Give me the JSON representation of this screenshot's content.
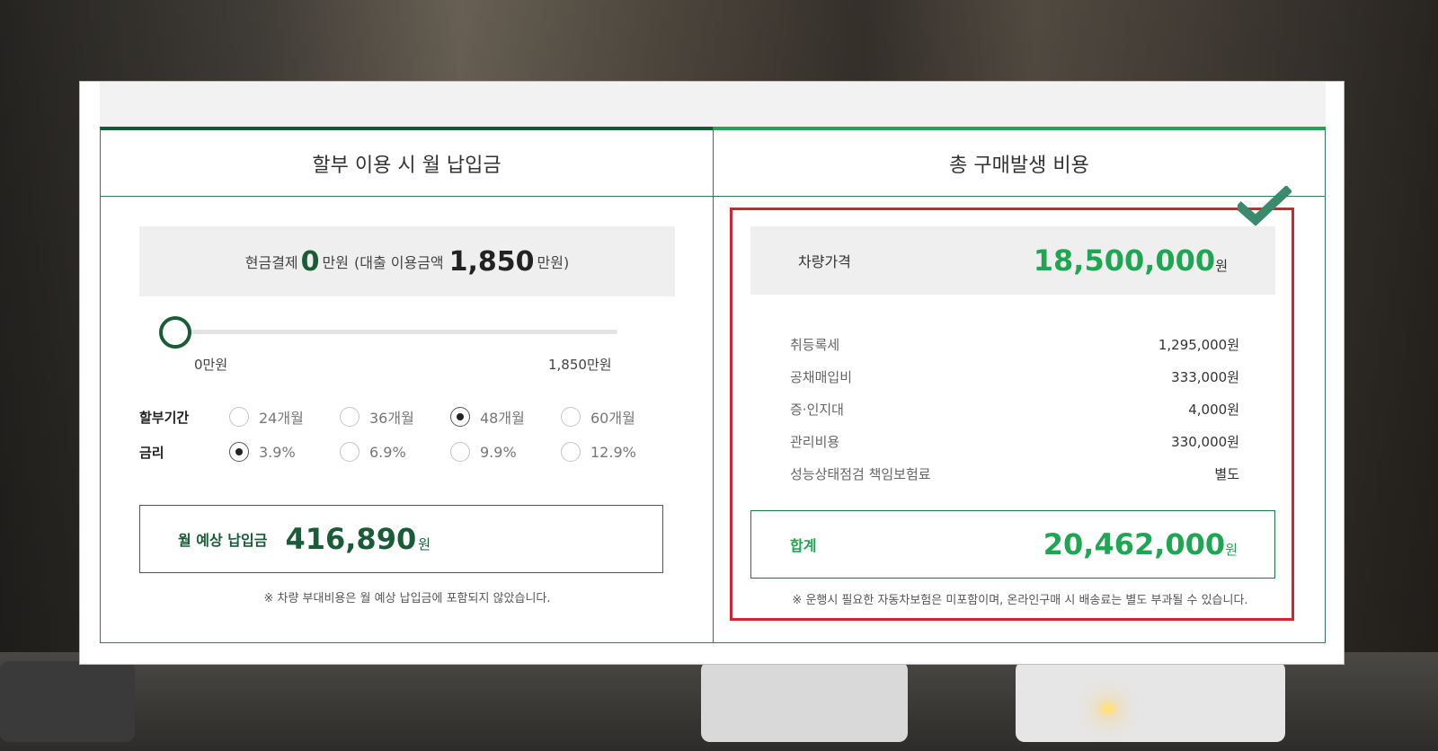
{
  "installment_panel": {
    "title": "할부 이용 시 월 납입금",
    "cash": {
      "prefix": "현금결제",
      "cash_value": "0",
      "cash_unit": "만원",
      "loan_prefix": "(대출 이용금액",
      "loan_value": "1,850",
      "loan_unit": "만원)"
    },
    "slider": {
      "min_label": "0만원",
      "max_label": "1,850만원",
      "position_fraction": 0
    },
    "period": {
      "label": "할부기간",
      "options": [
        "24개월",
        "36개월",
        "48개월",
        "60개월"
      ],
      "selected": "48개월"
    },
    "rate": {
      "label": "금리",
      "options": [
        "3.9%",
        "6.9%",
        "9.9%",
        "12.9%"
      ],
      "selected": "3.9%"
    },
    "monthly": {
      "label": "월 예상 납입금",
      "value": "416,890",
      "unit": "원"
    },
    "note": "※ 차량 부대비용은 월 예상 납입금에 포함되지 않았습니다."
  },
  "purchase_panel": {
    "title": "총 구매발생 비용",
    "vehicle_price": {
      "label": "차량가격",
      "value": "18,500,000",
      "unit": "원"
    },
    "fees": [
      {
        "label": "취등록세",
        "amount": "1,295,000원"
      },
      {
        "label": "공채매입비",
        "amount": "333,000원"
      },
      {
        "label": "증·인지대",
        "amount": "4,000원"
      },
      {
        "label": "관리비용",
        "amount": "330,000원"
      },
      {
        "label": "성능상태점검 책임보험료",
        "amount": "별도"
      }
    ],
    "total": {
      "label": "합계",
      "value": "20,462,000",
      "unit": "원"
    },
    "note": "※ 운행시 필요한 자동차보험은 미포함이며, 온라인구매 시 배송료는 별도 부과될 수 있습니다."
  },
  "colors": {
    "dark_green": "#1a5c38",
    "bright_green": "#1fa653",
    "highlight_red": "#d7232d",
    "check_green": "#3c8a6e"
  },
  "icons": {
    "checkmark": "check-icon"
  }
}
